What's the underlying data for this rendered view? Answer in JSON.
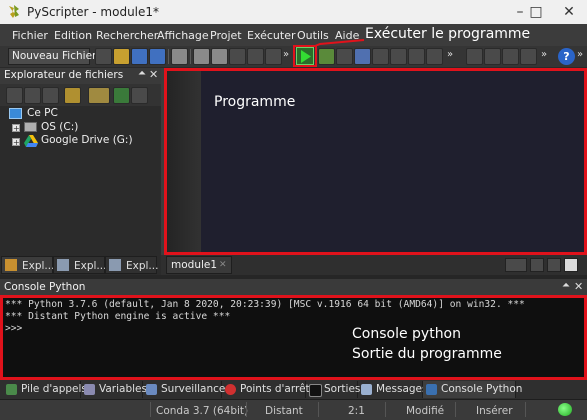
{
  "window": {
    "title": "PyScripter - module1*"
  },
  "menu": [
    "Fichier",
    "Edition",
    "Rechercher",
    "Affichage",
    "Projet",
    "Exécuter",
    "Outils",
    "Aide"
  ],
  "toolbar": {
    "new_file_label": "Nouveau Fichier..."
  },
  "annotation": {
    "run_label": "Exécuter le programme"
  },
  "explorer": {
    "title": "Explorateur de fichiers",
    "tree": {
      "root": "Ce PC",
      "items": [
        "OS (C:)",
        "Google Drive (G:)"
      ]
    },
    "tabs": [
      "Expl...",
      "Expl...",
      "Expl..."
    ]
  },
  "editor": {
    "label": "Programme",
    "tab": "module1"
  },
  "console": {
    "title": "Console Python",
    "lines": [
      "*** Python 3.7.6 (default, Jan  8 2020, 20:23:39) [MSC v.1916 64 bit (AMD64)] on win32. ***",
      "*** Distant Python engine is active ***",
      ">>>"
    ],
    "notes": [
      "Console python",
      "Sortie du programme"
    ]
  },
  "bottom_tabs": [
    "Pile d'appels",
    "Variables",
    "Surveillances",
    "Points d'arrêts",
    "Sorties",
    "Messages",
    "Console Python"
  ],
  "status": [
    "Conda 3.7 (64bit)",
    "Distant",
    "2:1",
    "Modifié",
    "Insérer"
  ],
  "colors": {
    "highlight": "#e0121b",
    "run_green": "#2a6e2a"
  }
}
